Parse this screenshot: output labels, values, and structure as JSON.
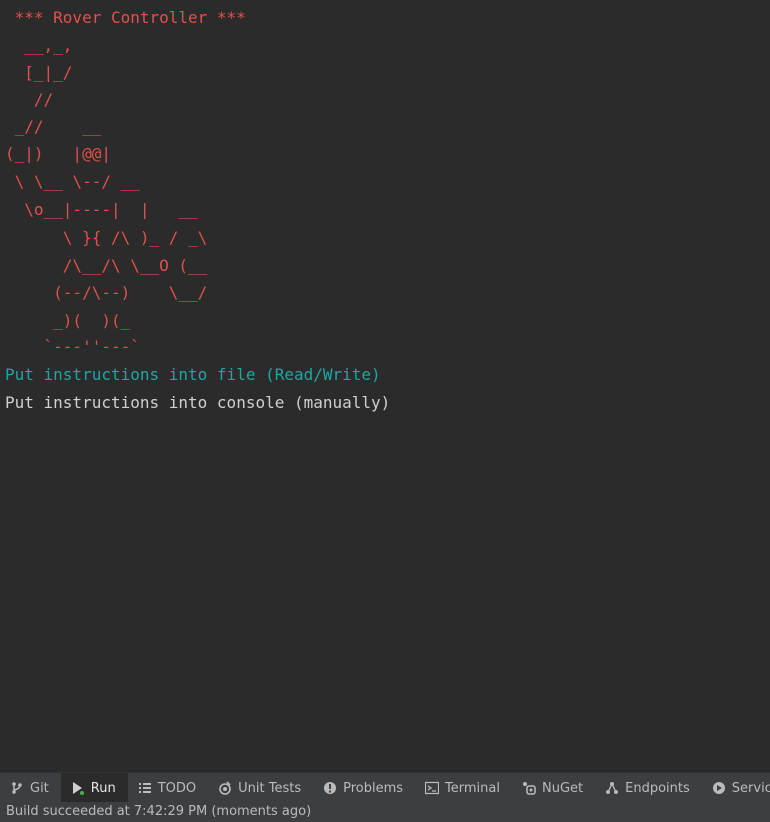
{
  "console": {
    "title": " *** Rover Controller ***",
    "art": [
      "  __,_,",
      "  [_|_/",
      "   //",
      " _//    __",
      "(_|)   |@@|",
      " \\ \\__ \\--/ __",
      "  \\o__|----|  |   __",
      "      \\ }{ /\\ )_ / _\\",
      "      /\\__/\\ \\__O (__",
      "     (--/\\--)    \\__/",
      "     _)(  )(_",
      "    `---''---`"
    ],
    "menu_options": [
      {
        "label": "Put instructions into file (Read/Write)",
        "selected": true
      },
      {
        "label": "Put instructions into console (manually)",
        "selected": false
      }
    ]
  },
  "toolbar": {
    "tabs": [
      {
        "label": "Git",
        "icon": "git-branch-icon",
        "active": false
      },
      {
        "label": "Run",
        "icon": "run-icon",
        "active": true
      },
      {
        "label": "TODO",
        "icon": "todo-list-icon",
        "active": false
      },
      {
        "label": "Unit Tests",
        "icon": "unit-tests-icon",
        "active": false
      },
      {
        "label": "Problems",
        "icon": "problems-icon",
        "active": false
      },
      {
        "label": "Terminal",
        "icon": "terminal-icon",
        "active": false
      },
      {
        "label": "NuGet",
        "icon": "nuget-icon",
        "active": false
      },
      {
        "label": "Endpoints",
        "icon": "endpoints-icon",
        "active": false
      },
      {
        "label": "Services",
        "icon": "services-icon",
        "active": false
      }
    ]
  },
  "status": {
    "text": "Build succeeded at 7:42:29 PM  (moments ago)"
  },
  "colors": {
    "background": "#2b2b2b",
    "art_red": "#e0514c",
    "selected_cyan": "#1ea6a6",
    "normal_text": "#d0d0d0",
    "run_green": "#4caf50"
  }
}
